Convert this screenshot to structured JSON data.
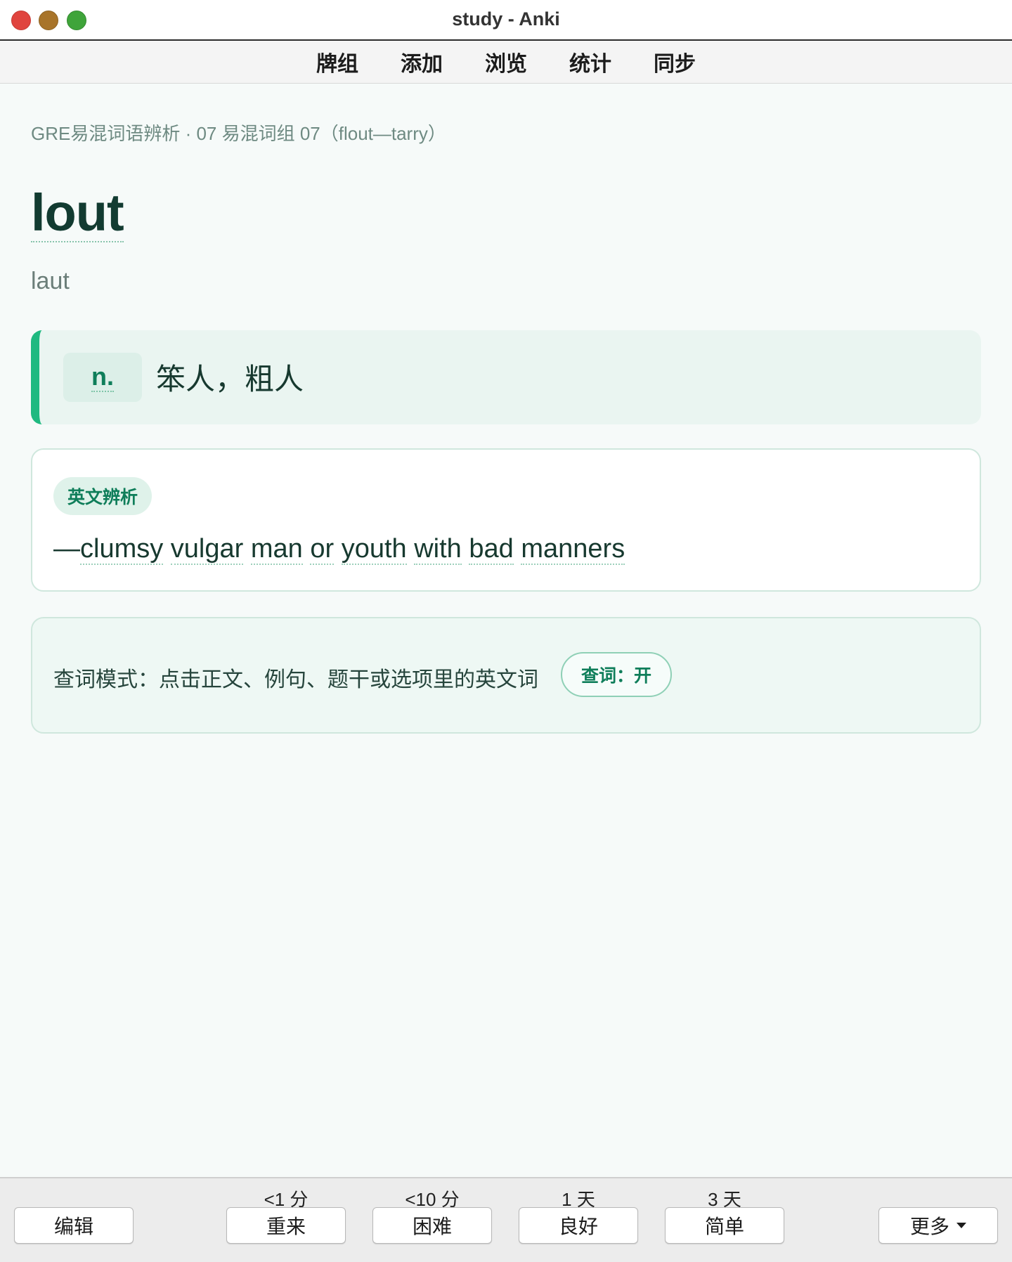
{
  "window": {
    "title": "study - Anki"
  },
  "toolbar": {
    "items": [
      "牌组",
      "添加",
      "浏览",
      "统计",
      "同步"
    ]
  },
  "card": {
    "deck_path": "GRE易混词语辨析 · 07 易混词组 07（flout—tarry）",
    "headword": "lout",
    "phonetic": "laut",
    "pos": "n.",
    "meaning": "笨人，粗人",
    "analysis_tag": "英文辨析",
    "definition_prefix": "—",
    "definition_words": [
      "clumsy",
      "vulgar",
      "man",
      "or",
      "youth",
      "with",
      "bad",
      "manners"
    ]
  },
  "lookup": {
    "description": "查词模式：点击正文、例句、题干或选项里的英文词",
    "toggle_label": "查词：开"
  },
  "answer_bar": {
    "edit_label": "编辑",
    "more_label": "更多",
    "buttons": [
      {
        "label": "重来",
        "interval": "<1 分"
      },
      {
        "label": "困难",
        "interval": "<10 分"
      },
      {
        "label": "良好",
        "interval": "1 天"
      },
      {
        "label": "简单",
        "interval": "3 天"
      }
    ]
  },
  "colors": {
    "accent": "#1fb980",
    "accent_text": "#0f7e5a",
    "headword": "#123b31",
    "background": "#f6faf9"
  }
}
